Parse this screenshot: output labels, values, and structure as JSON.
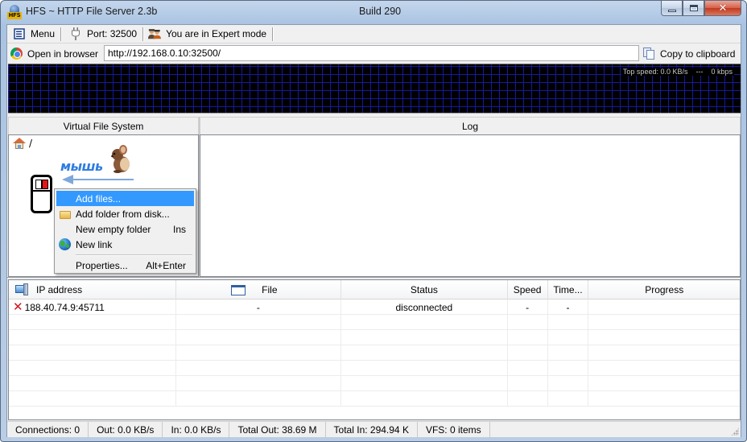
{
  "window": {
    "title": "HFS ~ HTTP File Server 2.3b",
    "build": "Build 290",
    "app_icon_label": "HFS",
    "controls": {
      "minimize": "minimize",
      "maximize": "maximize",
      "close": "✕"
    }
  },
  "toolbar": {
    "menu_label": "Menu",
    "port_label": "Port: 32500",
    "mode_label": "You are in Expert mode"
  },
  "url_bar": {
    "open_browser_label": "Open in browser",
    "url_value": "http://192.168.0.10:32500/",
    "copy_label": "Copy to clipboard"
  },
  "graph": {
    "top_speed_label": "Top speed: 0.0 KB/s    ---    0 kbps"
  },
  "vfs": {
    "header": "Virtual File System",
    "root_label": "/",
    "overlay_word": "мышь"
  },
  "log": {
    "header": "Log"
  },
  "context_menu": {
    "items": [
      {
        "label": "Add files...",
        "shortcut": "",
        "icon": "none",
        "highlighted": true
      },
      {
        "label": "Add folder from disk...",
        "shortcut": "",
        "icon": "folder-icon",
        "highlighted": false
      },
      {
        "label": "New empty folder",
        "shortcut": "Ins",
        "icon": "none",
        "highlighted": false
      },
      {
        "label": "New link",
        "shortcut": "",
        "icon": "globe-icon",
        "highlighted": false
      },
      {
        "label": "Properties...",
        "shortcut": "Alt+Enter",
        "icon": "none",
        "highlighted": false
      }
    ]
  },
  "connections": {
    "columns": [
      "IP address",
      "File",
      "Status",
      "Speed",
      "Time...",
      "Progress"
    ],
    "rows": [
      {
        "ip": "188.40.74.9:45711",
        "file": "-",
        "status": "disconnected",
        "speed": "-",
        "time": "-",
        "progress": "",
        "status_icon": "x-icon"
      }
    ]
  },
  "statusbar": {
    "connections": "Connections: 0",
    "out": "Out: 0.0 KB/s",
    "in": "In: 0.0 KB/s",
    "total_out": "Total Out: 38.69 M",
    "total_in": "Total In: 294.94 K",
    "vfs": "VFS: 0 items"
  }
}
